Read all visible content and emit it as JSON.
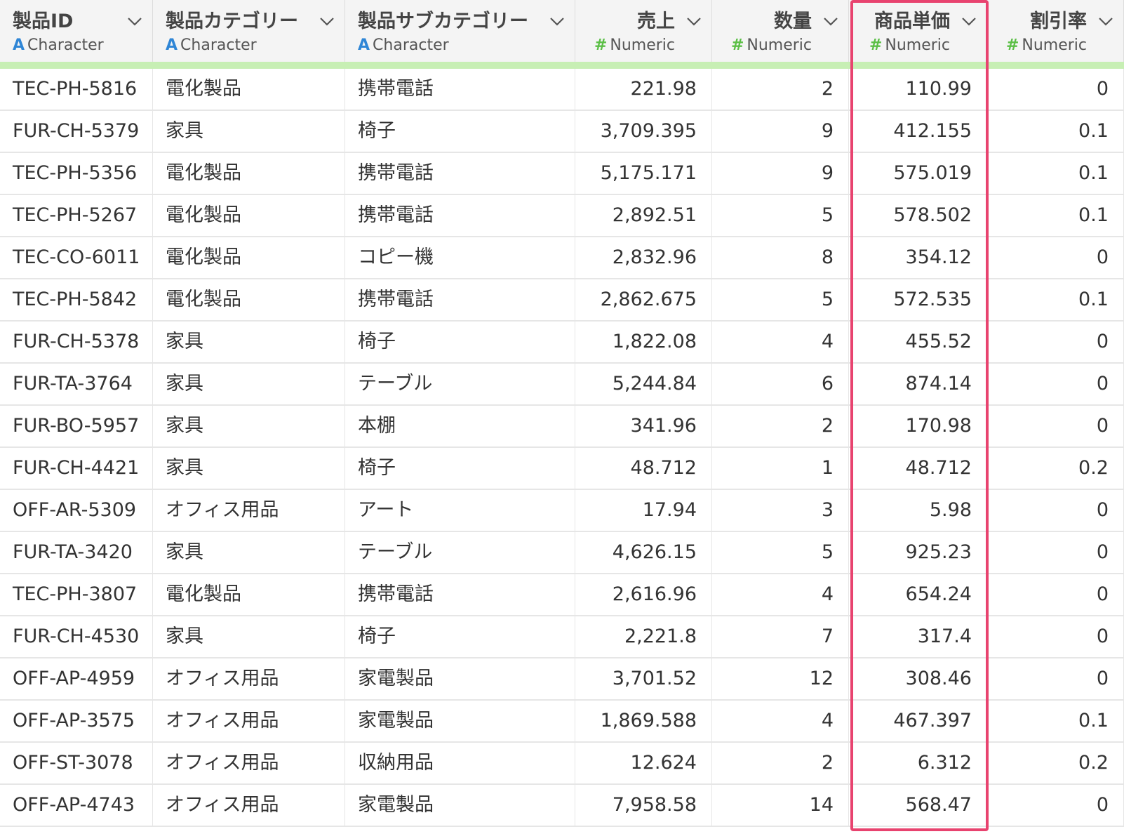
{
  "columns": [
    {
      "name": "製品ID",
      "type_icon": "A",
      "type": "Character"
    },
    {
      "name": "製品カテゴリー",
      "type_icon": "A",
      "type": "Character"
    },
    {
      "name": "製品サブカテゴリー",
      "type_icon": "A",
      "type": "Character"
    },
    {
      "name": "売上",
      "type_icon": "#",
      "type": "Numeric"
    },
    {
      "name": "数量",
      "type_icon": "#",
      "type": "Numeric"
    },
    {
      "name": "商品単価",
      "type_icon": "#",
      "type": "Numeric"
    },
    {
      "name": "割引率",
      "type_icon": "#",
      "type": "Numeric"
    }
  ],
  "rows": [
    [
      "TEC-PH-5816",
      "電化製品",
      "携帯電話",
      "221.98",
      "2",
      "110.99",
      "0"
    ],
    [
      "FUR-CH-5379",
      "家具",
      "椅子",
      "3,709.395",
      "9",
      "412.155",
      "0.1"
    ],
    [
      "TEC-PH-5356",
      "電化製品",
      "携帯電話",
      "5,175.171",
      "9",
      "575.019",
      "0.1"
    ],
    [
      "TEC-PH-5267",
      "電化製品",
      "携帯電話",
      "2,892.51",
      "5",
      "578.502",
      "0.1"
    ],
    [
      "TEC-CO-6011",
      "電化製品",
      "コピー機",
      "2,832.96",
      "8",
      "354.12",
      "0"
    ],
    [
      "TEC-PH-5842",
      "電化製品",
      "携帯電話",
      "2,862.675",
      "5",
      "572.535",
      "0.1"
    ],
    [
      "FUR-CH-5378",
      "家具",
      "椅子",
      "1,822.08",
      "4",
      "455.52",
      "0"
    ],
    [
      "FUR-TA-3764",
      "家具",
      "テーブル",
      "5,244.84",
      "6",
      "874.14",
      "0"
    ],
    [
      "FUR-BO-5957",
      "家具",
      "本棚",
      "341.96",
      "2",
      "170.98",
      "0"
    ],
    [
      "FUR-CH-4421",
      "家具",
      "椅子",
      "48.712",
      "1",
      "48.712",
      "0.2"
    ],
    [
      "OFF-AR-5309",
      "オフィス用品",
      "アート",
      "17.94",
      "3",
      "5.98",
      "0"
    ],
    [
      "FUR-TA-3420",
      "家具",
      "テーブル",
      "4,626.15",
      "5",
      "925.23",
      "0"
    ],
    [
      "TEC-PH-3807",
      "電化製品",
      "携帯電話",
      "2,616.96",
      "4",
      "654.24",
      "0"
    ],
    [
      "FUR-CH-4530",
      "家具",
      "椅子",
      "2,221.8",
      "7",
      "317.4",
      "0"
    ],
    [
      "OFF-AP-4959",
      "オフィス用品",
      "家電製品",
      "3,701.52",
      "12",
      "308.46",
      "0"
    ],
    [
      "OFF-AP-3575",
      "オフィス用品",
      "家電製品",
      "1,869.588",
      "4",
      "467.397",
      "0.1"
    ],
    [
      "OFF-ST-3078",
      "オフィス用品",
      "収納用品",
      "12.624",
      "2",
      "6.312",
      "0.2"
    ],
    [
      "OFF-AP-4743",
      "オフィス用品",
      "家電製品",
      "7,958.58",
      "14",
      "568.47",
      "0"
    ]
  ],
  "colors": {
    "header_bg": "#f4f4f4",
    "character_icon": "#2f86d6",
    "numeric_icon": "#5bbf46",
    "quality_bar": "#c7efb4",
    "highlight_border": "#e8436f"
  },
  "highlighted_column": "商品単価"
}
